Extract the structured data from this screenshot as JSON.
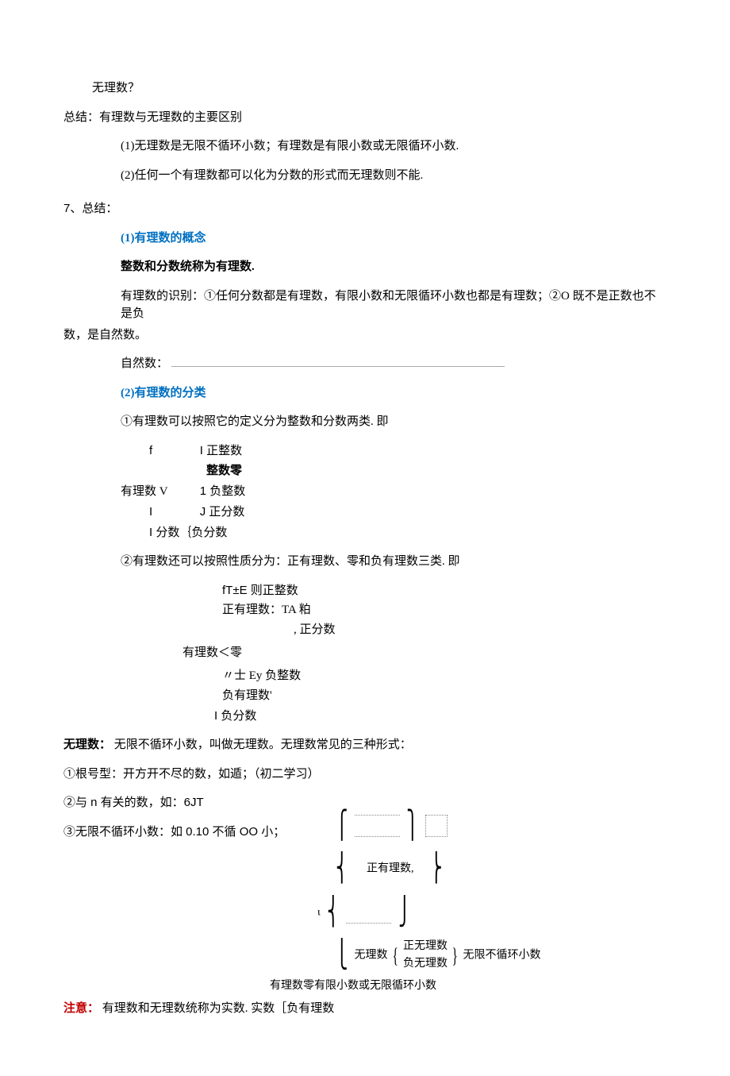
{
  "l1": "无理数？",
  "l2": "总结：有理数与无理数的主要区别",
  "l3": "(1)无理数是无限不循环小数；有理数是有限小数或无限循环小数.",
  "l4": "(2)任何一个有理数都可以化为分数的形式而无理数则不能.",
  "section7": "7、总结：",
  "s7_1": "(1)有理数的概念",
  "s7_1b": "整数和分数统称为有理数.",
  "s7_1c": "有理数的识别：①任何分数都是有理数，有限小数和无限循环小数也都是有理数；②O 既不是正数也不是负",
  "s7_1d": "数，是自然数。",
  "s7_1e_label": "自然数：",
  "s7_2": "(2)有理数的分类",
  "s7_2a": "①有理数可以按照它的定义分为整数和分数两类. 即",
  "tree1_r1a": "f",
  "tree1_r1b": "I 正整数",
  "tree1_r2": "整数零",
  "tree1_r3a": "有理数 V",
  "tree1_r3b": "1 负整数",
  "tree1_r4a": "I",
  "tree1_r4b": "J 正分数",
  "tree1_r5": "I 分数｛负分数",
  "s7_2b": "②有理数还可以按照性质分为：正有理数、零和负有理数三类. 即",
  "tree2_r1": "fT±E 则正整数",
  "tree2_r2": "正有理数：TA 粕",
  "tree2_r3": ", 正分数",
  "tree2_r4": "有理数＜零",
  "tree2_r5": "〃士 Ey 负整数",
  "tree2_r6": "负有理数'",
  "tree2_r7": "I 负分数",
  "irr_label": "无理数：",
  "irr_text": "无限不循环小数，叫做无理数。无理数常见的三种形式：",
  "irr_1": "①根号型：开方开不尽的数，如遁；（初二学习）",
  "irr_2": "②与 n 有关的数，如：6JT",
  "irr_3": "③无限不循环小数：如 0.10 不循 OO 小；",
  "fig_r1": "正有理数,",
  "fig_r2a": "无理数",
  "fig_r2b": "正无理数",
  "fig_r2c": "负无理数",
  "fig_r2d": "无限不循环小数",
  "fig_r3": "有理数零有限小数或无限循环小数",
  "note_label": "注意：",
  "note_text": "有理数和无理数统称为实数. 实数［负有理数",
  "iota": "ι"
}
